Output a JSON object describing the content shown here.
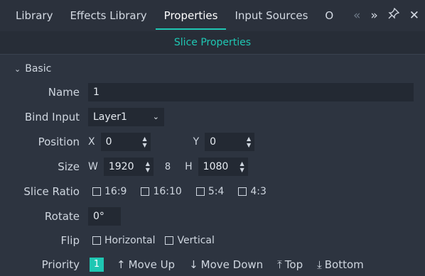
{
  "tabs": [
    {
      "label": "Library"
    },
    {
      "label": "Effects Library"
    },
    {
      "label": "Properties"
    },
    {
      "label": "Input Sources"
    },
    {
      "label": "O"
    }
  ],
  "tab_icons": {
    "prev": "«",
    "next": "»",
    "pin": "☆",
    "close": "✕"
  },
  "panel_title": "Slice Properties",
  "section": {
    "label": "Basic",
    "chevron": "⌄"
  },
  "fields": {
    "name": {
      "label": "Name",
      "value": "1"
    },
    "bind_input": {
      "label": "Bind Input",
      "value": "Layer1",
      "arrow": "⌄"
    },
    "position": {
      "label": "Position",
      "x_axis": "X",
      "x_value": "0",
      "y_axis": "Y",
      "y_value": "0"
    },
    "size": {
      "label": "Size",
      "w_axis": "W",
      "w_value": "1920",
      "link": "8",
      "h_axis": "H",
      "h_value": "1080"
    },
    "slice_ratio": {
      "label": "Slice Ratio",
      "options": [
        "16:9",
        "16:10",
        "5:4",
        "4:3"
      ]
    },
    "rotate": {
      "label": "Rotate",
      "value": "0°"
    },
    "flip": {
      "label": "Flip",
      "options": [
        "Horizontal",
        "Vertical"
      ]
    },
    "priority": {
      "label": "Priority",
      "value": "1",
      "move_up": "Move Up",
      "move_down": "Move Down",
      "top": "Top",
      "bottom": "Bottom"
    }
  },
  "colors": {
    "accent": "#1fc7b3",
    "background": "#2d3440",
    "input_bg": "#232933"
  }
}
